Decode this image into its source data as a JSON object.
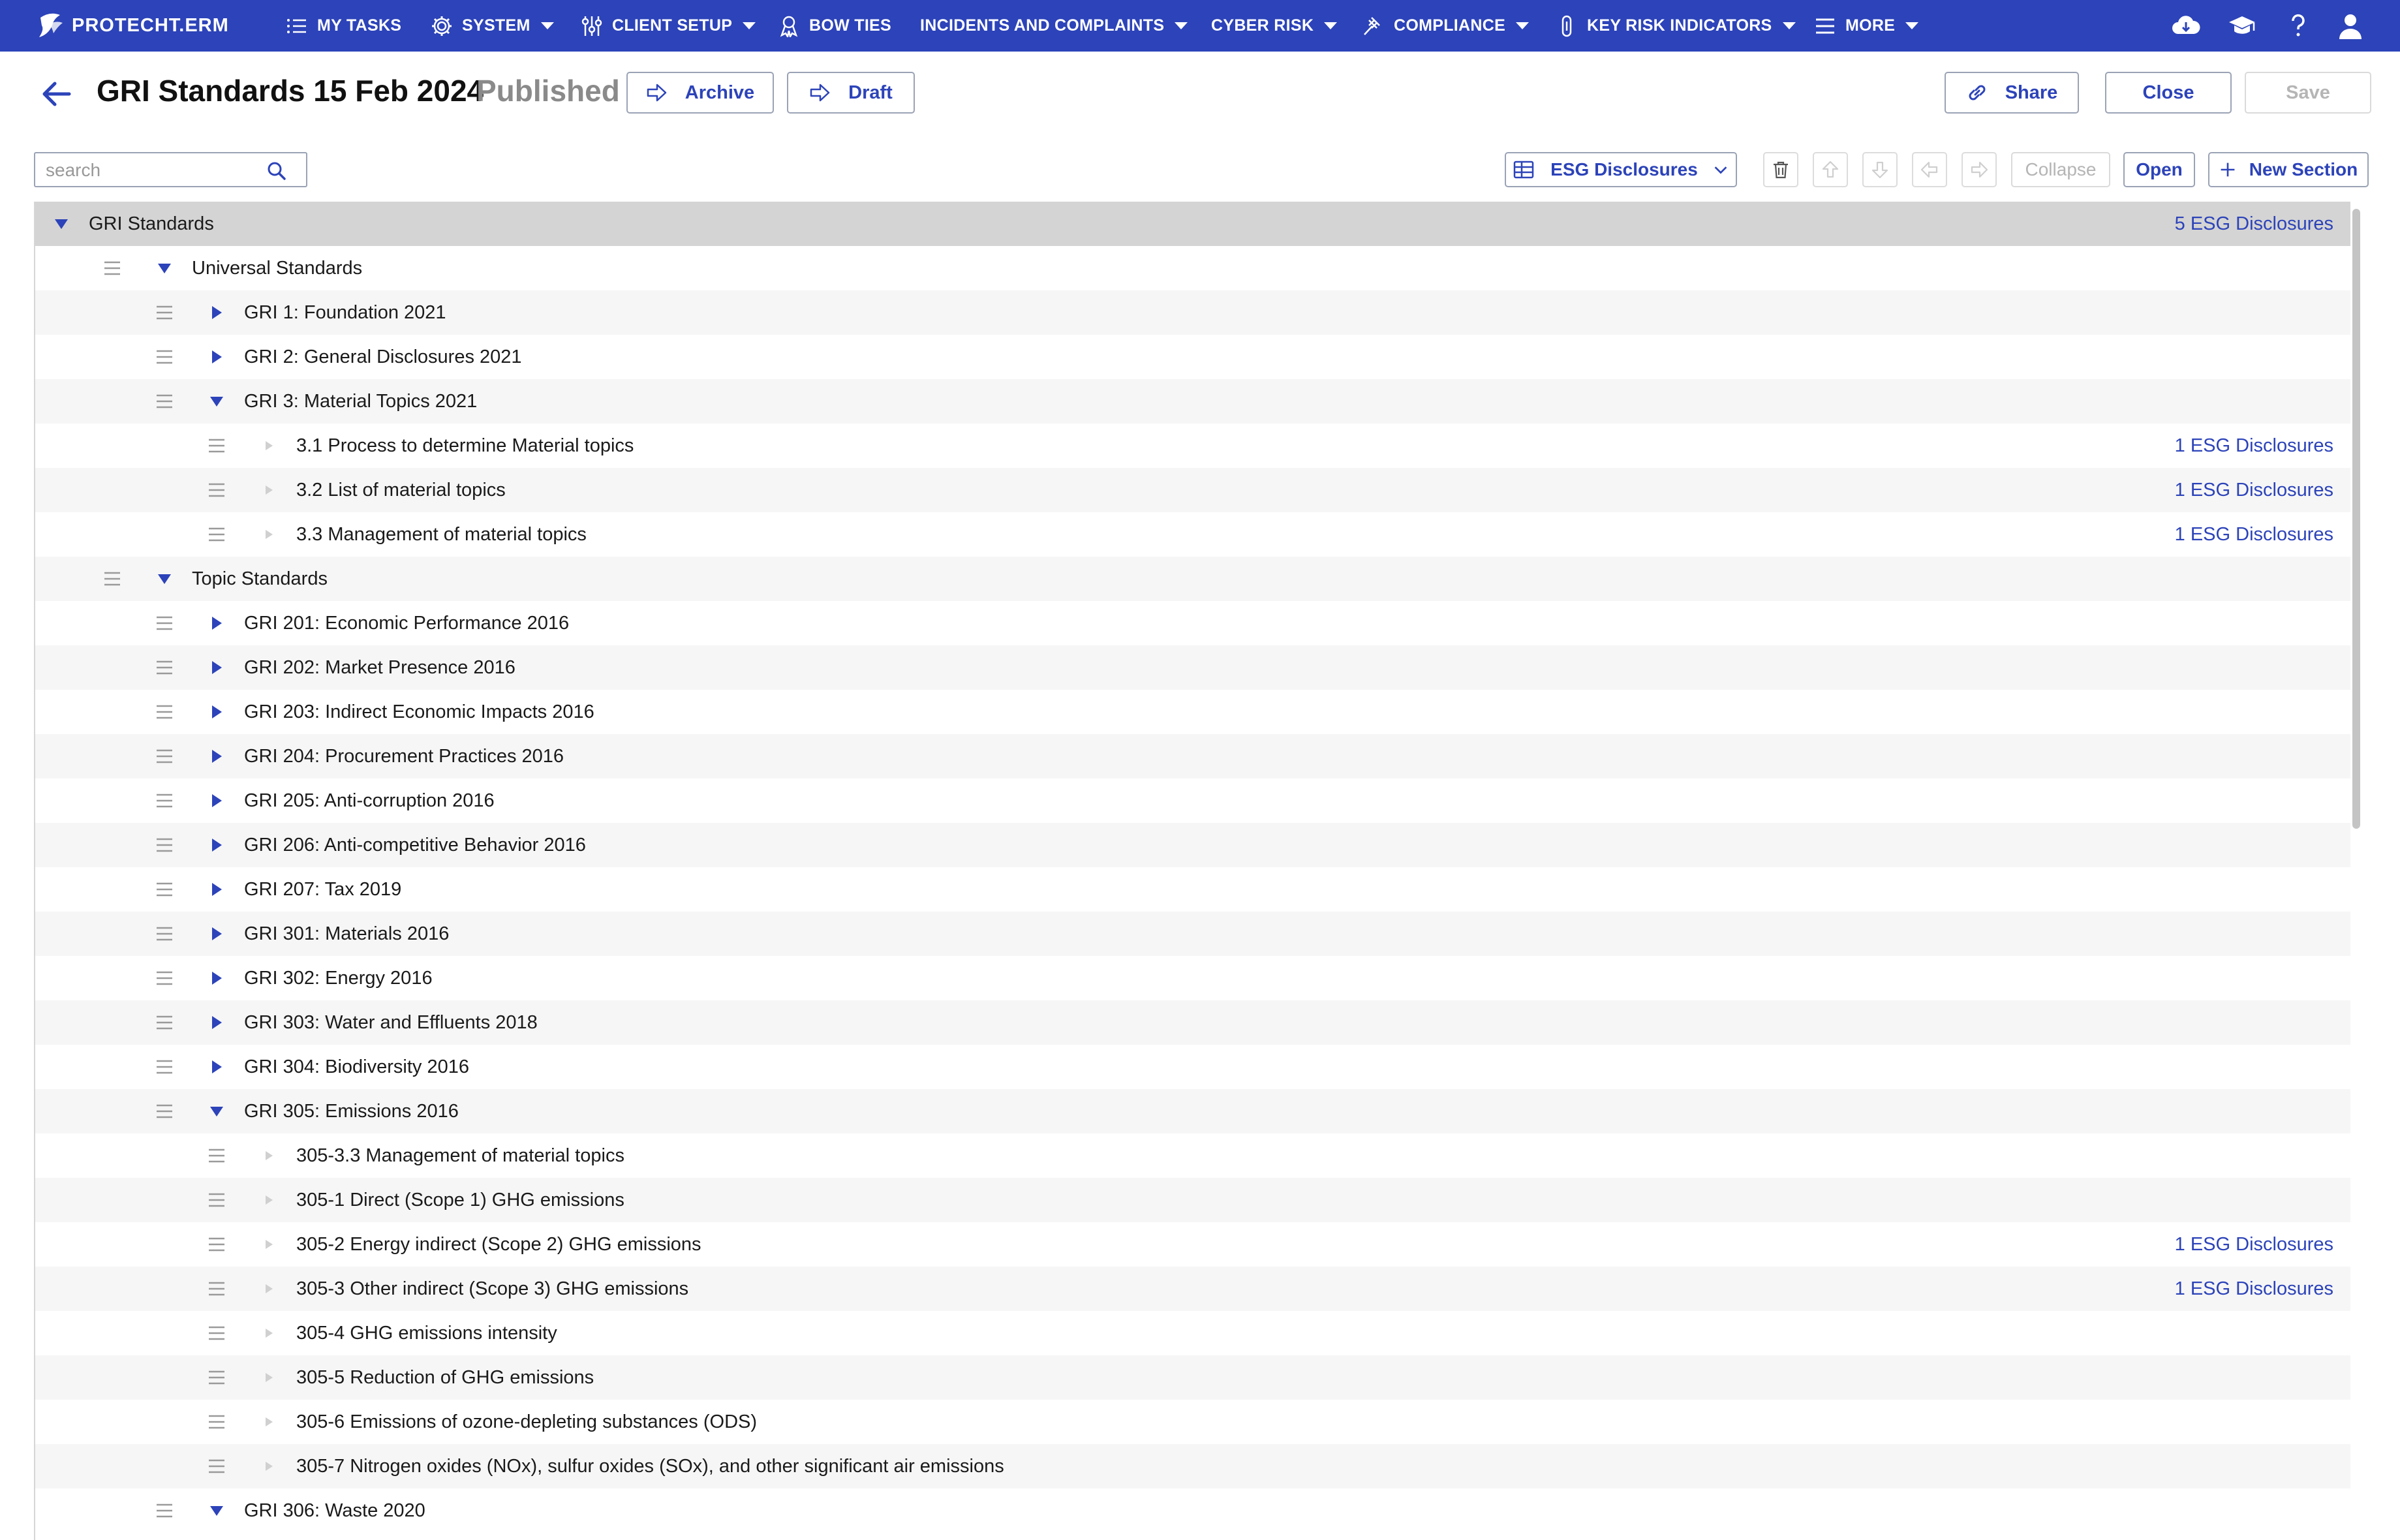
{
  "nav": {
    "brand": "PROTECHT.ERM",
    "items": [
      {
        "label": "MY TASKS",
        "icon": "list-icon",
        "caret": false
      },
      {
        "label": "SYSTEM",
        "icon": "gear-icon",
        "caret": true
      },
      {
        "label": "CLIENT SETUP",
        "icon": "sliders-icon",
        "caret": true
      },
      {
        "label": "BOW TIES",
        "icon": "ribbon-icon",
        "caret": false
      },
      {
        "label": "INCIDENTS AND COMPLAINTS",
        "icon": "",
        "caret": true
      },
      {
        "label": "CYBER RISK",
        "icon": "",
        "caret": true
      },
      {
        "label": "COMPLIANCE",
        "icon": "gavel-icon",
        "caret": true
      },
      {
        "label": "KEY RISK INDICATORS",
        "icon": "thermometer-icon",
        "caret": true
      },
      {
        "label": "MORE",
        "icon": "menu-icon",
        "caret": true
      }
    ]
  },
  "header": {
    "title": "GRI Standards 15 Feb 2024",
    "status": "Published",
    "archive_label": "Archive",
    "draft_label": "Draft",
    "share_label": "Share",
    "close_label": "Close",
    "save_label": "Save"
  },
  "toolbar": {
    "search_placeholder": "search",
    "view_select": "ESG Disclosures",
    "collapse_label": "Collapse",
    "open_label": "Open",
    "new_section_label": "New Section"
  },
  "tree": {
    "rows": [
      {
        "label": "GRI Standards",
        "level": 0,
        "state": "expanded",
        "count": "5 ESG Disclosures",
        "handle": false
      },
      {
        "label": "Universal Standards",
        "level": 1,
        "state": "expanded",
        "count": "",
        "handle": true
      },
      {
        "label": "GRI 1: Foundation 2021",
        "level": 2,
        "state": "collapsed",
        "count": "",
        "handle": true
      },
      {
        "label": "GRI 2: General Disclosures 2021",
        "level": 2,
        "state": "collapsed",
        "count": "",
        "handle": true
      },
      {
        "label": "GRI 3: Material Topics 2021",
        "level": 2,
        "state": "expanded",
        "count": "",
        "handle": true
      },
      {
        "label": "3.1 Process to determine Material topics",
        "level": 3,
        "state": "leaf",
        "count": "1 ESG Disclosures",
        "handle": true
      },
      {
        "label": "3.2 List of material topics",
        "level": 3,
        "state": "leaf",
        "count": "1 ESG Disclosures",
        "handle": true
      },
      {
        "label": "3.3 Management of material topics",
        "level": 3,
        "state": "leaf",
        "count": "1 ESG Disclosures",
        "handle": true
      },
      {
        "label": "Topic Standards",
        "level": 1,
        "state": "expanded",
        "count": "",
        "handle": true
      },
      {
        "label": "GRI 201: Economic Performance 2016",
        "level": 2,
        "state": "collapsed",
        "count": "",
        "handle": true
      },
      {
        "label": "GRI 202: Market Presence 2016",
        "level": 2,
        "state": "collapsed",
        "count": "",
        "handle": true
      },
      {
        "label": "GRI 203: Indirect Economic Impacts 2016",
        "level": 2,
        "state": "collapsed",
        "count": "",
        "handle": true
      },
      {
        "label": "GRI 204: Procurement Practices 2016",
        "level": 2,
        "state": "collapsed",
        "count": "",
        "handle": true
      },
      {
        "label": "GRI 205: Anti-corruption 2016",
        "level": 2,
        "state": "collapsed",
        "count": "",
        "handle": true
      },
      {
        "label": "GRI 206: Anti-competitive Behavior 2016",
        "level": 2,
        "state": "collapsed",
        "count": "",
        "handle": true
      },
      {
        "label": "GRI 207: Tax 2019",
        "level": 2,
        "state": "collapsed",
        "count": "",
        "handle": true
      },
      {
        "label": "GRI 301: Materials 2016",
        "level": 2,
        "state": "collapsed",
        "count": "",
        "handle": true
      },
      {
        "label": "GRI 302: Energy 2016",
        "level": 2,
        "state": "collapsed",
        "count": "",
        "handle": true
      },
      {
        "label": "GRI 303: Water and Effluents 2018",
        "level": 2,
        "state": "collapsed",
        "count": "",
        "handle": true
      },
      {
        "label": "GRI 304: Biodiversity 2016",
        "level": 2,
        "state": "collapsed",
        "count": "",
        "handle": true
      },
      {
        "label": "GRI 305: Emissions 2016",
        "level": 2,
        "state": "expanded",
        "count": "",
        "handle": true
      },
      {
        "label": "305-3.3 Management of material topics",
        "level": 3,
        "state": "leaf",
        "count": "",
        "handle": true
      },
      {
        "label": "305-1 Direct (Scope 1) GHG emissions",
        "level": 3,
        "state": "leaf",
        "count": "",
        "handle": true
      },
      {
        "label": "305-2 Energy indirect (Scope 2) GHG emissions",
        "level": 3,
        "state": "leaf",
        "count": "1 ESG Disclosures",
        "handle": true
      },
      {
        "label": "305-3 Other indirect (Scope 3) GHG emissions",
        "level": 3,
        "state": "leaf",
        "count": "1 ESG Disclosures",
        "handle": true
      },
      {
        "label": "305-4 GHG emissions intensity",
        "level": 3,
        "state": "leaf",
        "count": "",
        "handle": true
      },
      {
        "label": "305-5 Reduction of GHG emissions",
        "level": 3,
        "state": "leaf",
        "count": "",
        "handle": true
      },
      {
        "label": "305-6 Emissions of ozone-depleting substances (ODS)",
        "level": 3,
        "state": "leaf",
        "count": "",
        "handle": true
      },
      {
        "label": "305-7 Nitrogen oxides (NOx), sulfur oxides (SOx), and other significant air emissions",
        "level": 3,
        "state": "leaf",
        "count": "",
        "handle": true
      },
      {
        "label": "GRI 306: Waste 2020",
        "level": 2,
        "state": "expanded",
        "count": "",
        "handle": true
      }
    ]
  },
  "colors": {
    "brand_blue": "#2c43b9",
    "root_row": "#d4d4d4",
    "alt_row": "#f6f6f6",
    "muted": "#8a8a8a"
  }
}
